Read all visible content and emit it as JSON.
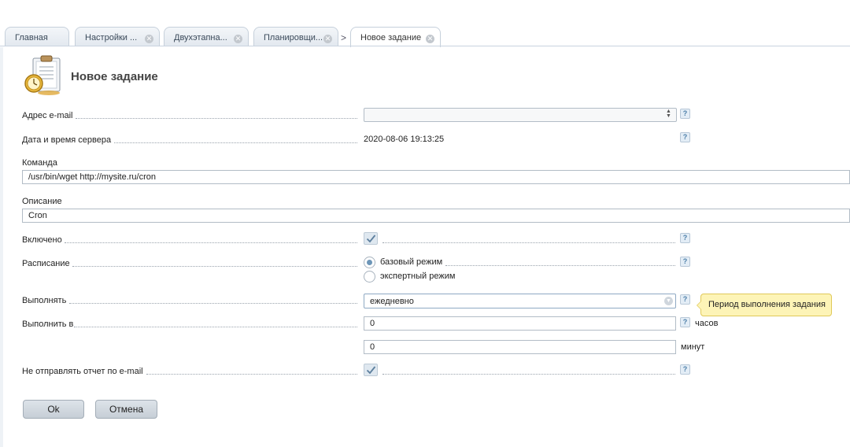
{
  "tabs": [
    {
      "label": "Главная",
      "closable": false
    },
    {
      "label": "Настройки ...",
      "closable": true
    },
    {
      "label": "Двухэтапна...",
      "closable": true
    },
    {
      "label": "Планировщи...",
      "closable": true
    },
    {
      "label": "Новое задание",
      "closable": true,
      "active": true
    }
  ],
  "tab_overflow_arrow": ">",
  "page": {
    "title": "Новое задание",
    "icon": "clipboard-clock-icon"
  },
  "form": {
    "email": {
      "label": "Адрес e-mail",
      "value": "",
      "placeholder": ""
    },
    "server_datetime": {
      "label": "Дата и время сервера",
      "value": "2020-08-06 19:13:25"
    },
    "command": {
      "label": "Команда",
      "value": "/usr/bin/wget http://mysite.ru/cron"
    },
    "description": {
      "label": "Описание",
      "value": "Cron"
    },
    "enabled": {
      "label": "Включено",
      "checked": true
    },
    "schedule": {
      "label": "Расписание",
      "options": [
        {
          "label": "базовый режим",
          "selected": true
        },
        {
          "label": "экспертный режим",
          "selected": false
        }
      ]
    },
    "run": {
      "label": "Выполнять",
      "value": "ежедневно",
      "tooltip": "Период выполнения задания"
    },
    "run_at": {
      "label": "Выполнить в",
      "hours": {
        "value": "0",
        "unit": "часов"
      },
      "minutes": {
        "value": "0",
        "unit": "минут"
      }
    },
    "no_report": {
      "label": "Не отправлять отчет по e-mail",
      "checked": true
    },
    "help_glyph": "?"
  },
  "buttons": {
    "ok": "Ok",
    "cancel": "Отмена"
  },
  "colors": {
    "help_bg": "#e3edf6",
    "tooltip_bg": "#fdf4b7",
    "radio_on": "#6d96b8"
  }
}
